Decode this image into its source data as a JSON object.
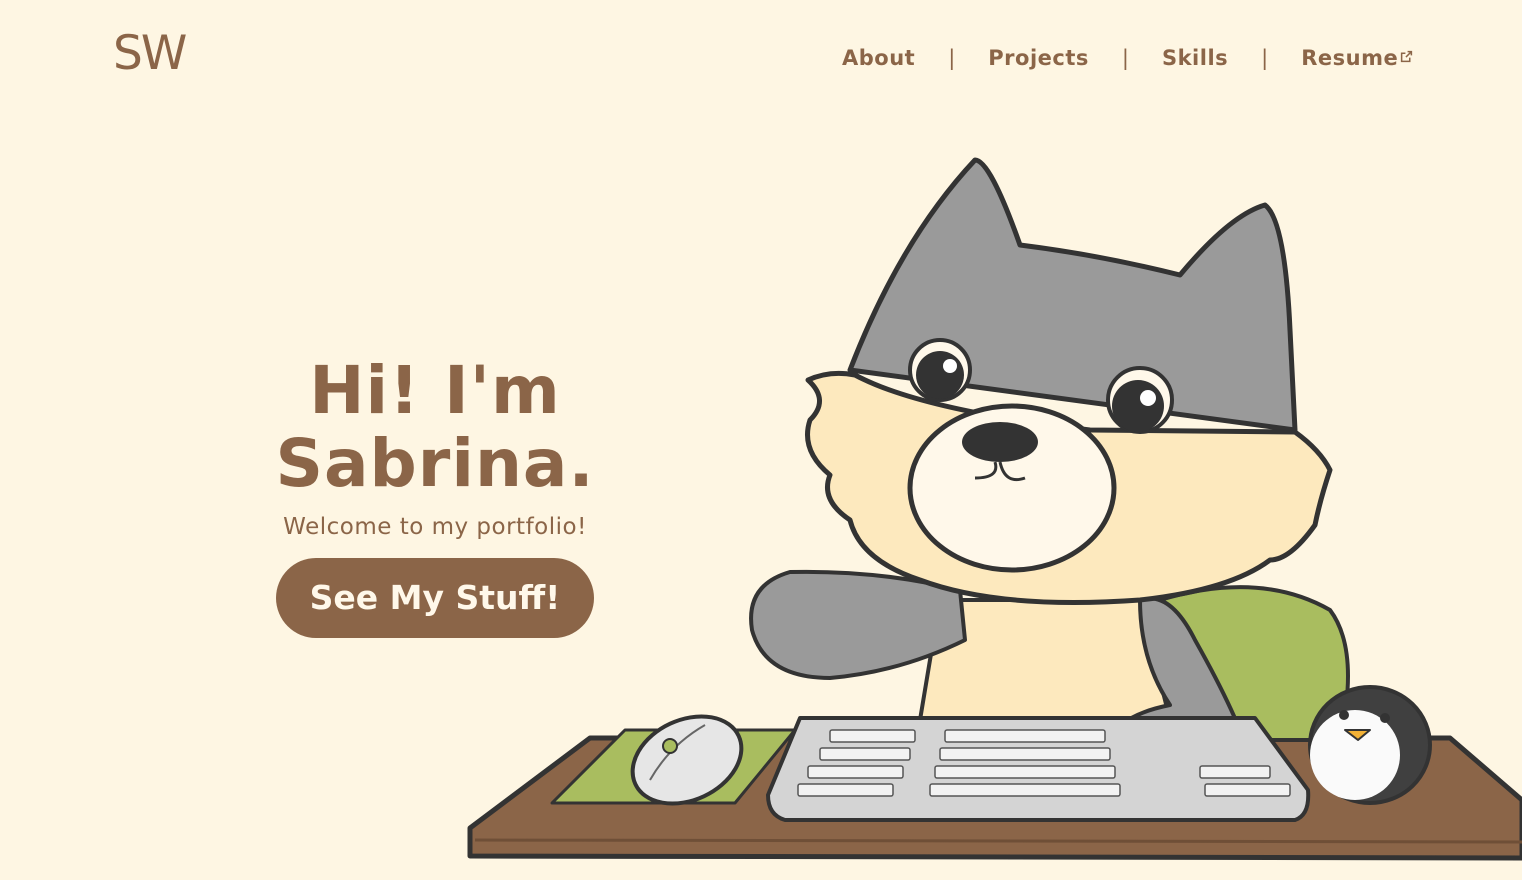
{
  "header": {
    "logo": "SW",
    "nav": [
      {
        "label": "About"
      },
      {
        "label": "Projects"
      },
      {
        "label": "Skills"
      },
      {
        "label": "Resume",
        "icon": "external-link-icon"
      }
    ],
    "separator": "|"
  },
  "hero": {
    "title": "Hi! I'm Sabrina.",
    "subtitle": "Welcome to my portfolio!",
    "cta_label": "See My Stuff!"
  },
  "illustration": {
    "subject": "cartoon-wolf-at-desk",
    "colors": {
      "fur_gray": "#9a9a9a",
      "fur_cream": "#fde9be",
      "desk": "#8b6548",
      "accent_green": "#a9bd5f",
      "outline": "#333333"
    }
  },
  "colors": {
    "background": "#fef6e3",
    "brand": "#8b6548",
    "button_text": "#fff8ea"
  }
}
